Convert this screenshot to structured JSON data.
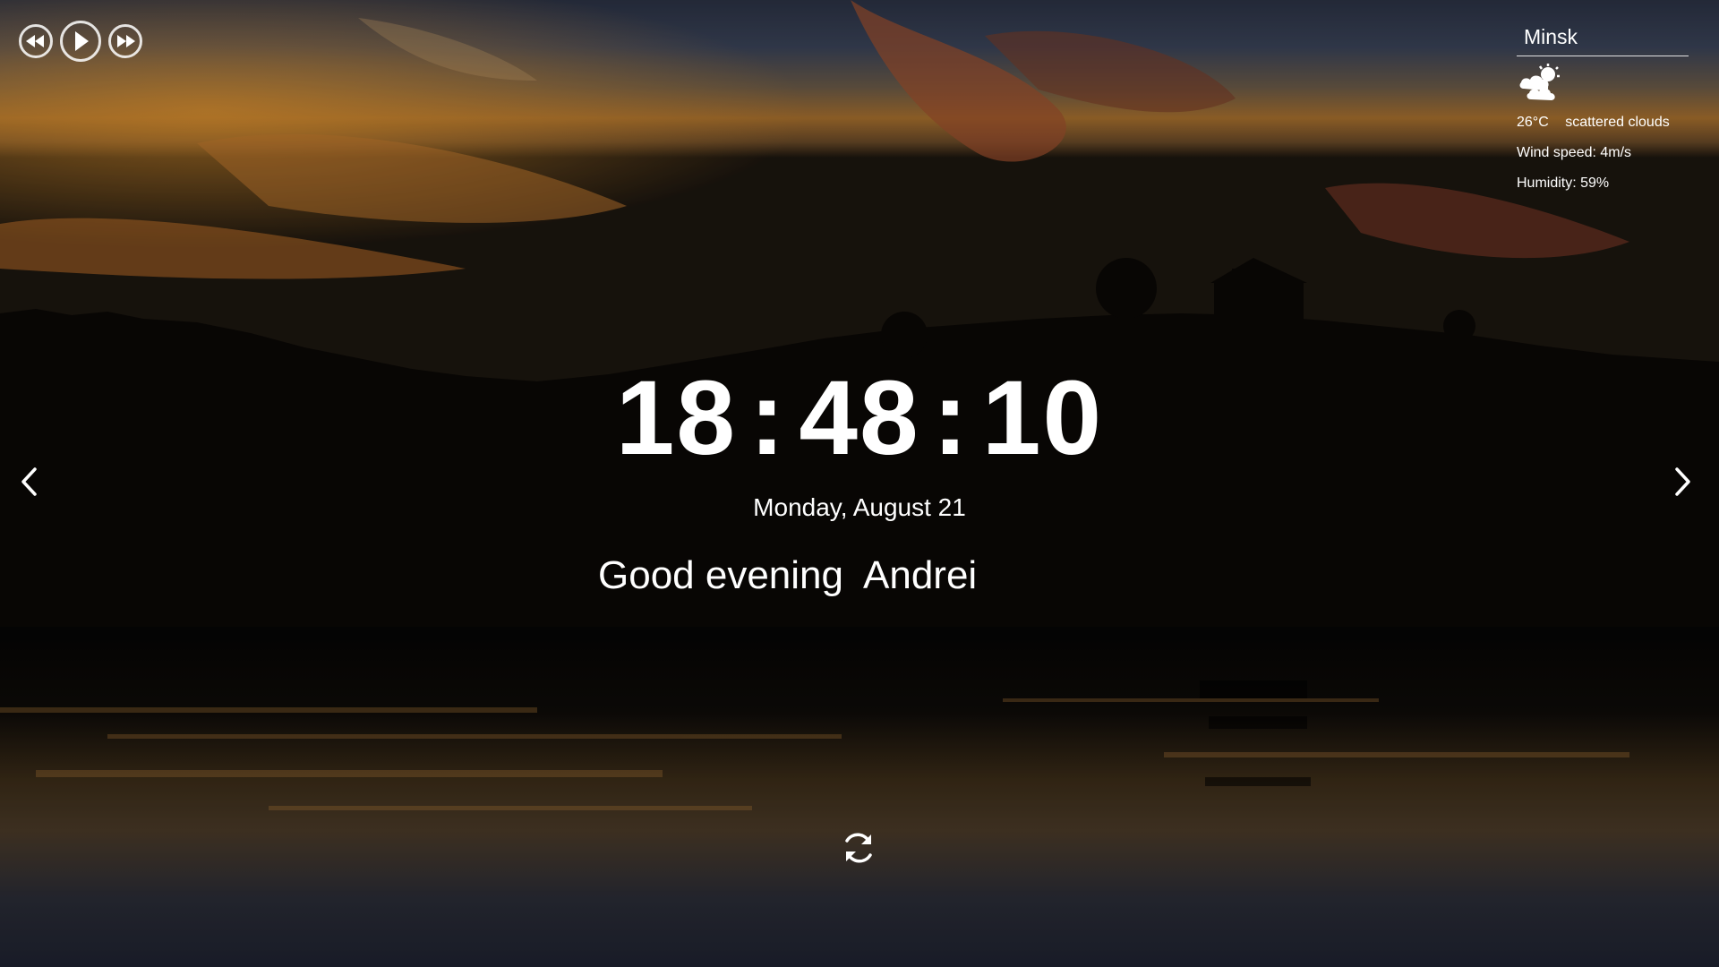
{
  "media_controls": {
    "previous_icon": "rewind-icon",
    "play_icon": "play-icon",
    "next_icon": "fast-forward-icon"
  },
  "weather": {
    "city": "Minsk",
    "icon": "partly-cloudy-icon",
    "temperature": "26°C",
    "condition": "scattered clouds",
    "wind": "Wind speed: 4m/s",
    "humidity": "Humidity: 59%"
  },
  "clock": {
    "hours": "18",
    "minutes": "48",
    "seconds": "10",
    "separator": ":"
  },
  "date": "Monday, August 21",
  "greeting": {
    "text": "Good evening",
    "name": "Andrei"
  },
  "navigation": {
    "prev_icon": "chevron-left-icon",
    "next_icon": "chevron-right-icon"
  },
  "refresh_icon": "refresh-icon",
  "colors": {
    "text": "#ffffff",
    "sky_top": "#2a3550",
    "sunset": "#c8782a",
    "water": "#2a2e3a"
  }
}
